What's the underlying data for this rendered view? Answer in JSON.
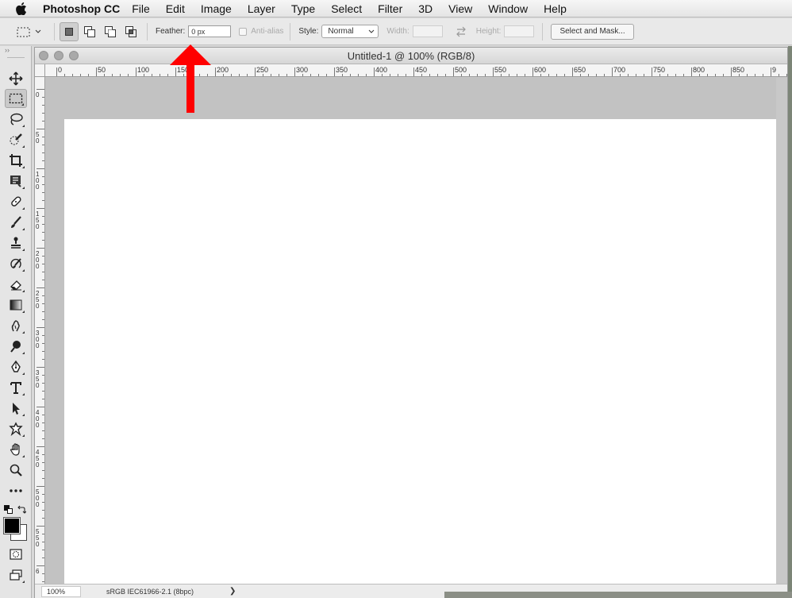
{
  "menubar": {
    "app_name": "Photoshop CC",
    "items": [
      "File",
      "Edit",
      "Image",
      "Layer",
      "Type",
      "Select",
      "Filter",
      "3D",
      "View",
      "Window",
      "Help"
    ]
  },
  "options": {
    "feather_label": "Feather:",
    "feather_value": "0 px",
    "antialias_label": "Anti-alias",
    "style_label": "Style:",
    "style_value": "Normal",
    "width_label": "Width:",
    "height_label": "Height:",
    "select_mask_label": "Select and Mask..."
  },
  "document": {
    "title": "Untitled-1 @ 100% (RGB/8)",
    "ruler_h_labels": [
      "0",
      "50",
      "100",
      "150",
      "200",
      "250",
      "300",
      "350",
      "400",
      "450",
      "500",
      "550",
      "600",
      "650",
      "700",
      "750",
      "800",
      "850",
      "9"
    ],
    "ruler_v_labels": [
      "0",
      "50",
      "100",
      "150",
      "200",
      "250",
      "300",
      "350",
      "400",
      "450",
      "500",
      "550",
      "6"
    ]
  },
  "status": {
    "zoom": "100%",
    "profile": "sRGB IEC61966-2.1 (8bpc)",
    "arrow": "❯"
  },
  "tools": [
    "move-tool",
    "rectangular-marquee-tool",
    "lasso-tool",
    "quick-selection-tool",
    "crop-tool",
    "frame-tool",
    "spot-healing-tool",
    "brush-tool",
    "clone-stamp-tool",
    "history-brush-tool",
    "eraser-tool",
    "gradient-tool",
    "blur-tool",
    "dodge-tool",
    "pen-tool",
    "type-tool",
    "path-selection-tool",
    "custom-shape-tool",
    "hand-tool",
    "zoom-tool",
    "edit-toolbar"
  ],
  "colors": {
    "foreground": "#000000",
    "background": "#ffffff",
    "annotation_arrow": "#ff0000"
  }
}
